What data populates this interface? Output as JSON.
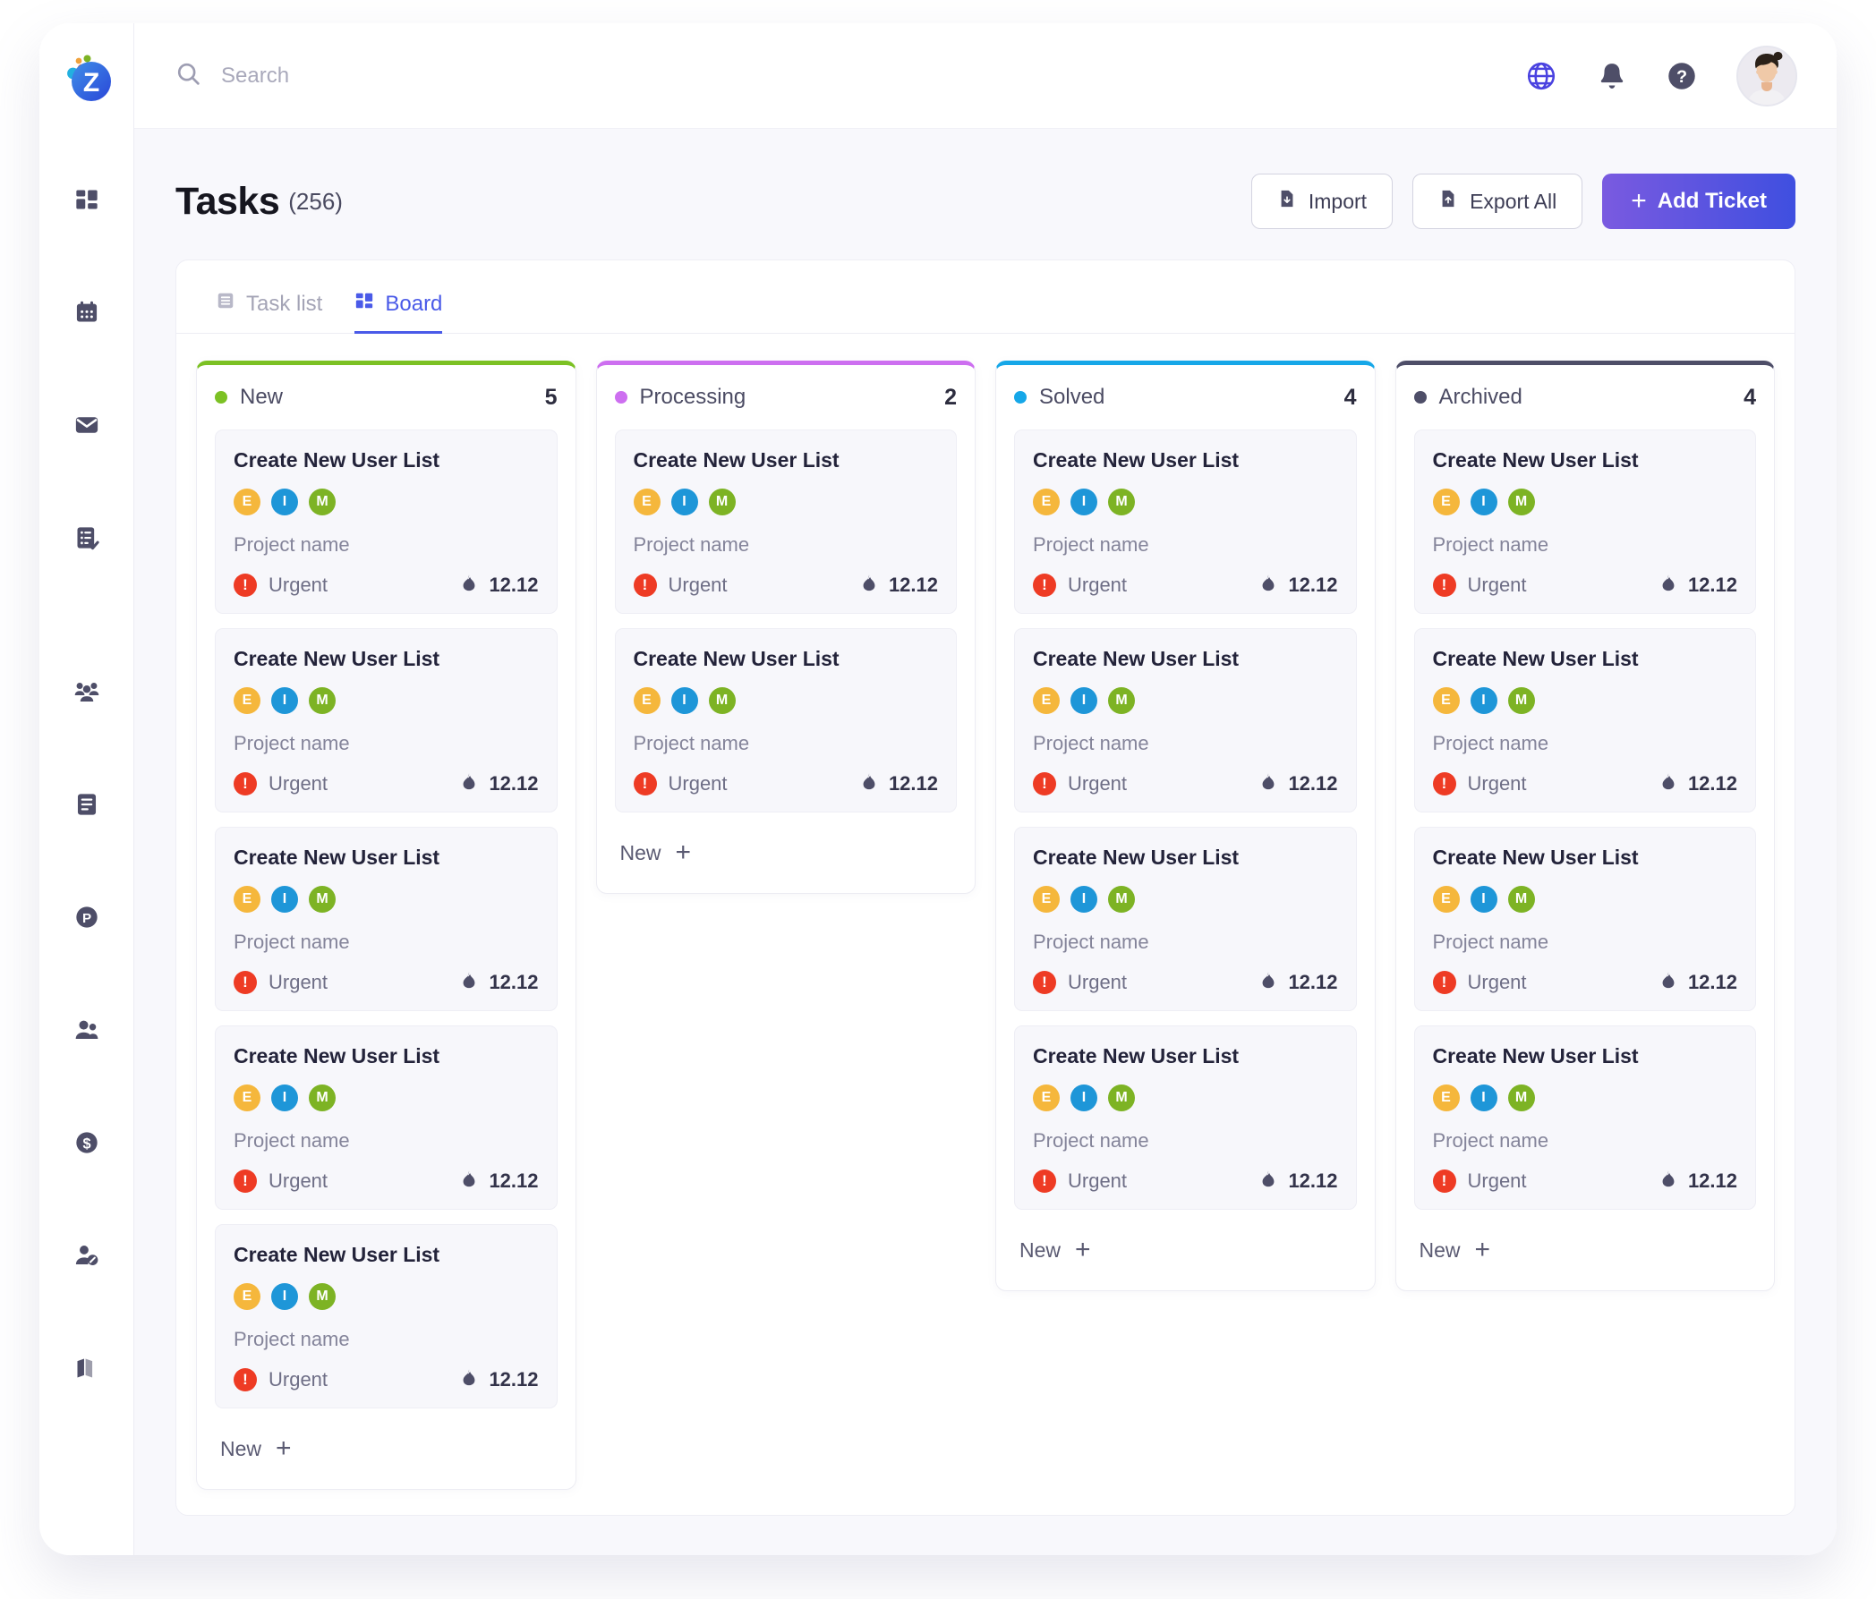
{
  "brand": {
    "logo_letter": "Z",
    "logo_icon": "zendesk-logo-icon"
  },
  "topbar": {
    "search_placeholder": "Search",
    "search_value": "",
    "icons": [
      "globe-icon",
      "bell-icon",
      "help-circle-icon"
    ],
    "avatar": "user-avatar"
  },
  "sidebar": {
    "items": [
      {
        "icon": "dashboard-grid-icon",
        "name": "dashboard"
      },
      {
        "icon": "calendar-icon",
        "name": "calendar"
      },
      {
        "icon": "mail-icon",
        "name": "mail"
      },
      {
        "icon": "task-list-check-icon",
        "name": "tasks"
      },
      {
        "icon": "people-group-icon",
        "name": "teams"
      },
      {
        "icon": "document-icon",
        "name": "documents"
      },
      {
        "icon": "p-circle-icon",
        "name": "projects"
      },
      {
        "icon": "two-people-icon",
        "name": "contacts"
      },
      {
        "icon": "dollar-circle-icon",
        "name": "billing"
      },
      {
        "icon": "user-settings-icon",
        "name": "account"
      },
      {
        "icon": "map-icon",
        "name": "map"
      }
    ]
  },
  "page": {
    "title": "Tasks",
    "count": "(256)"
  },
  "header_actions": {
    "import_label": "Import",
    "export_label": "Export All",
    "add_ticket_label": "Add Ticket",
    "add_ticket_plus": "+",
    "accent_gradient_from": "#7a5ae0",
    "accent_gradient_to": "#3f4fe0"
  },
  "tabs": [
    {
      "label": "Task list",
      "icon": "list-icon",
      "active": false
    },
    {
      "label": "Board",
      "icon": "board-grid-icon",
      "active": true
    }
  ],
  "card_defaults": {
    "title": "Create New User List",
    "project": "Project name",
    "priority": "Urgent",
    "priority_color": "#ee3b24",
    "priority_glyph": "!",
    "due": "12.12",
    "due_icon": "flame-icon",
    "avatars": [
      {
        "initial": "E",
        "color": "#f5b73c"
      },
      {
        "initial": "I",
        "color": "#1e96d8"
      },
      {
        "initial": "M",
        "color": "#7db324"
      }
    ]
  },
  "columns": [
    {
      "name": "New",
      "count": "5",
      "accent": "#7cc124",
      "add_label": "New",
      "add_plus": "+",
      "cards": [
        {
          "title": "Create New User List",
          "project": "Project name",
          "priority": "Urgent",
          "due": "12.12"
        },
        {
          "title": "Create New User List",
          "project": "Project name",
          "priority": "Urgent",
          "due": "12.12"
        },
        {
          "title": "Create New User List",
          "project": "Project name",
          "priority": "Urgent",
          "due": "12.12"
        },
        {
          "title": "Create New User List",
          "project": "Project name",
          "priority": "Urgent",
          "due": "12.12"
        },
        {
          "title": "Create New User List",
          "project": "Project name",
          "priority": "Urgent",
          "due": "12.12"
        }
      ]
    },
    {
      "name": "Processing",
      "count": "2",
      "accent": "#cd6ff0",
      "add_label": "New",
      "add_plus": "+",
      "cards": [
        {
          "title": "Create New User List",
          "project": "Project name",
          "priority": "Urgent",
          "due": "12.12"
        },
        {
          "title": "Create New User List",
          "project": "Project name",
          "priority": "Urgent",
          "due": "12.12"
        }
      ]
    },
    {
      "name": "Solved",
      "count": "4",
      "accent": "#16a7e8",
      "add_label": "New",
      "add_plus": "+",
      "cards": [
        {
          "title": "Create New User List",
          "project": "Project name",
          "priority": "Urgent",
          "due": "12.12"
        },
        {
          "title": "Create New User List",
          "project": "Project name",
          "priority": "Urgent",
          "due": "12.12"
        },
        {
          "title": "Create New User List",
          "project": "Project name",
          "priority": "Urgent",
          "due": "12.12"
        },
        {
          "title": "Create New User List",
          "project": "Project name",
          "priority": "Urgent",
          "due": "12.12"
        }
      ]
    },
    {
      "name": "Archived",
      "count": "4",
      "accent": "#4e4e68",
      "add_label": "New",
      "add_plus": "+",
      "cards": [
        {
          "title": "Create New User List",
          "project": "Project name",
          "priority": "Urgent",
          "due": "12.12"
        },
        {
          "title": "Create New User List",
          "project": "Project name",
          "priority": "Urgent",
          "due": "12.12"
        },
        {
          "title": "Create New User List",
          "project": "Project name",
          "priority": "Urgent",
          "due": "12.12"
        },
        {
          "title": "Create New User List",
          "project": "Project name",
          "priority": "Urgent",
          "due": "12.12"
        }
      ]
    }
  ]
}
